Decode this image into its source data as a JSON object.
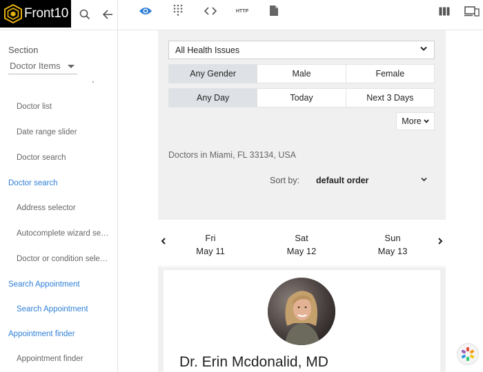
{
  "header": {
    "logo_text": "Front10",
    "http_label": "HTTP",
    "icons": [
      "search-icon",
      "back-arrow-icon",
      "eye-icon",
      "grid-dots-icon",
      "code-icon",
      "http-icon",
      "document-icon",
      "columns-icon",
      "devices-icon"
    ],
    "accent": "#2f7fd6"
  },
  "sidebar": {
    "section_label": "Section",
    "section_select": "Doctor Items",
    "items": [
      {
        "label": "Doctor list",
        "type": "item"
      },
      {
        "label": "Date range slider",
        "type": "item"
      },
      {
        "label": "Doctor search",
        "type": "item"
      },
      {
        "label": "Doctor search",
        "type": "heading"
      },
      {
        "label": "Address selector",
        "type": "item"
      },
      {
        "label": "Autocomplete wizard sea...",
        "type": "item"
      },
      {
        "label": "Doctor or condition selec...",
        "type": "item"
      },
      {
        "label": "Search Appointment",
        "type": "heading"
      },
      {
        "label": "Search Appointment",
        "type": "link"
      },
      {
        "label": "Appointment finder",
        "type": "heading"
      },
      {
        "label": "Appointment finder",
        "type": "item"
      }
    ]
  },
  "filters": {
    "health_issue": "All Health Issues",
    "gender": [
      "Any Gender",
      "Male",
      "Female"
    ],
    "gender_selected": "Any Gender",
    "day": [
      "Any Day",
      "Today",
      "Next 3 Days"
    ],
    "day_selected": "Any Day",
    "more_label": "More",
    "location": "Doctors in Miami, FL 33134, USA",
    "sort_label": "Sort by:",
    "sort_value": "default order"
  },
  "dates": [
    {
      "weekday": "Fri",
      "date": "May 11"
    },
    {
      "weekday": "Sat",
      "date": "May 12"
    },
    {
      "weekday": "Sun",
      "date": "May 13"
    }
  ],
  "doctor": {
    "name": "Dr. Erin Mcdonalid, MD"
  }
}
